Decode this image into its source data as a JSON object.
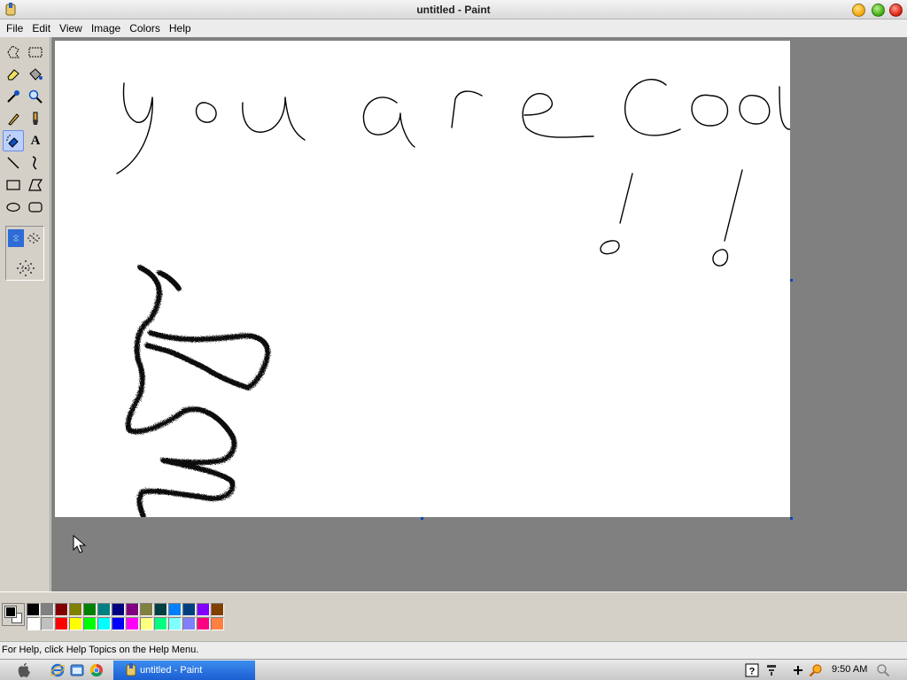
{
  "window": {
    "title": "untitled - Paint"
  },
  "menu": [
    "File",
    "Edit",
    "View",
    "Image",
    "Colors",
    "Help"
  ],
  "tools": [
    {
      "name": "free-form-select-icon"
    },
    {
      "name": "rect-select-icon"
    },
    {
      "name": "eraser-icon"
    },
    {
      "name": "fill-bucket-icon"
    },
    {
      "name": "color-picker-icon"
    },
    {
      "name": "magnifier-icon"
    },
    {
      "name": "pencil-icon"
    },
    {
      "name": "brush-icon"
    },
    {
      "name": "airbrush-icon",
      "active": true
    },
    {
      "name": "text-icon",
      "glyph": "A"
    },
    {
      "name": "line-icon"
    },
    {
      "name": "curve-icon"
    },
    {
      "name": "rectangle-icon"
    },
    {
      "name": "polygon-icon"
    },
    {
      "name": "ellipse-icon"
    },
    {
      "name": "rounded-rect-icon"
    }
  ],
  "palette": {
    "foreground": "#000000",
    "background": "#ffffff",
    "top_row": [
      "#000000",
      "#808080",
      "#800000",
      "#808000",
      "#008000",
      "#008080",
      "#000080",
      "#800080",
      "#808040",
      "#004040",
      "#0080ff",
      "#004080",
      "#8000ff",
      "#804000"
    ],
    "bottom_row": [
      "#ffffff",
      "#c0c0c0",
      "#ff0000",
      "#ffff00",
      "#00ff00",
      "#00ffff",
      "#0000ff",
      "#ff00ff",
      "#ffff80",
      "#00ff80",
      "#80ffff",
      "#8080ff",
      "#ff0080",
      "#ff8040"
    ]
  },
  "status": {
    "help_text": "For Help, click Help Topics on the Help Menu."
  },
  "taskbar": {
    "task_label": "untitled - Paint",
    "clock": "9:50 AM"
  },
  "canvas_text": "you are cool !!"
}
